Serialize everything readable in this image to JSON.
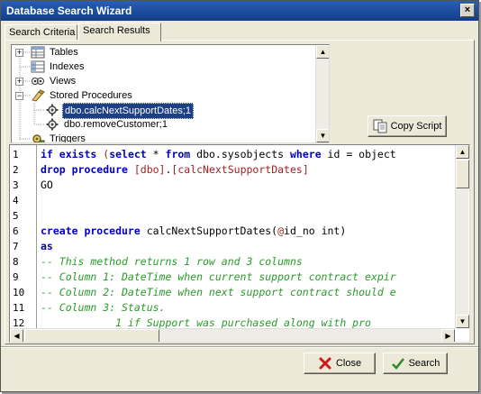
{
  "window": {
    "title": "Database Search Wizard",
    "close_glyph": "×"
  },
  "tabs": [
    {
      "label": "Search Criteria"
    },
    {
      "label": "Search Results"
    }
  ],
  "tree": {
    "nodes": [
      {
        "label": "Tables",
        "icon": "table-icon",
        "expander": "+"
      },
      {
        "label": "Indexes",
        "icon": "index-icon",
        "expander": ""
      },
      {
        "label": "Views",
        "icon": "view-icon",
        "expander": "+"
      },
      {
        "label": "Stored Procedures",
        "icon": "stored-procedure-icon",
        "expander": "−"
      },
      {
        "label": "dbo.calcNextSupportDates;1",
        "icon": "procedure-icon",
        "expander": ""
      },
      {
        "label": "dbo.removeCustomer;1",
        "icon": "procedure-icon",
        "expander": ""
      },
      {
        "label": "Triggers",
        "icon": "trigger-icon",
        "expander": ""
      }
    ]
  },
  "buttons": {
    "copy_script": "Copy Script",
    "close": "Close",
    "search": "Search"
  },
  "scroll_glyphs": {
    "up": "▲",
    "down": "▼",
    "left": "◀",
    "right": "▶"
  },
  "editor": {
    "line_numbers": [
      "1",
      "2",
      "3",
      "4",
      "5",
      "6",
      "7",
      "8",
      "9",
      "10",
      "11",
      "12"
    ],
    "lines": [
      {
        "parts": [
          [
            "kw",
            "if exists "
          ],
          [
            "br",
            "("
          ],
          [
            "kw",
            "select "
          ],
          [
            "",
            "* "
          ],
          [
            "kw",
            "from "
          ],
          [
            "",
            "dbo.sysobjects "
          ],
          [
            "kw",
            "where "
          ],
          [
            "",
            "id = object"
          ]
        ]
      },
      {
        "parts": [
          [
            "kw",
            "drop procedure "
          ],
          [
            "br",
            "[dbo]"
          ],
          [
            "",
            "."
          ],
          [
            "br",
            "[calcNextSupportDates]"
          ]
        ]
      },
      {
        "parts": [
          [
            "",
            "GO"
          ]
        ]
      },
      {
        "parts": [
          [
            "",
            ""
          ]
        ]
      },
      {
        "parts": [
          [
            "",
            ""
          ]
        ]
      },
      {
        "parts": [
          [
            "kw",
            "create procedure "
          ],
          [
            "",
            "calcNextSupportDates("
          ],
          [
            "br",
            "@"
          ],
          [
            "",
            "id_no int)"
          ]
        ]
      },
      {
        "parts": [
          [
            "kw",
            "as"
          ]
        ]
      },
      {
        "parts": [
          [
            "cm",
            "-- This method returns 1 row and 3 columns"
          ]
        ]
      },
      {
        "parts": [
          [
            "cm",
            "-- Column 1: DateTime when current support contract expir"
          ]
        ]
      },
      {
        "parts": [
          [
            "cm",
            "-- Column 2: DateTime when next support contract should e"
          ]
        ]
      },
      {
        "parts": [
          [
            "cm",
            "-- Column 3: Status."
          ]
        ]
      },
      {
        "parts": [
          [
            "cm",
            "            1 if Support was purchased along with pro"
          ]
        ]
      }
    ]
  },
  "colors": {
    "title_bar": "#1a4a99",
    "selection": "#1c3f86",
    "keyword": "#0000c0",
    "comment": "#2a9a2a"
  }
}
